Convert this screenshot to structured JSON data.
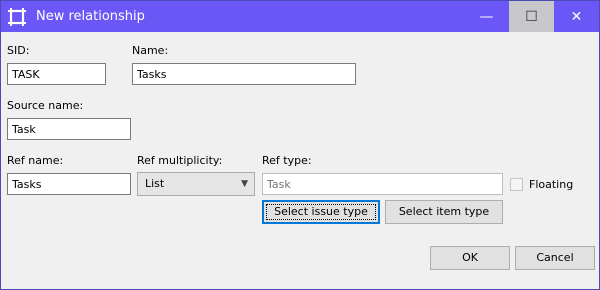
{
  "window": {
    "title": "New relationship",
    "icon": "relationship-icon",
    "controls": {
      "minimize": "—",
      "maximize": "☐",
      "close": "✕"
    }
  },
  "form": {
    "sid": {
      "label": "SID:",
      "value": "TASK"
    },
    "name": {
      "label": "Name:",
      "value": "Tasks"
    },
    "source_name": {
      "label": "Source name:",
      "value": "Task"
    },
    "ref_name": {
      "label": "Ref name:",
      "value": "Tasks"
    },
    "ref_multiplicity": {
      "label": "Ref multiplicity:",
      "value": "List",
      "options": [
        "List"
      ]
    },
    "ref_type": {
      "label": "Ref type:",
      "placeholder": "Task"
    },
    "floating": {
      "label": "Floating",
      "checked": false
    }
  },
  "buttons": {
    "select_issue_type": "Select issue type",
    "select_item_type": "Select item type",
    "ok": "OK",
    "cancel": "Cancel"
  },
  "colors": {
    "titlebar": "#6b57f5",
    "focus_border": "#0078d7"
  }
}
